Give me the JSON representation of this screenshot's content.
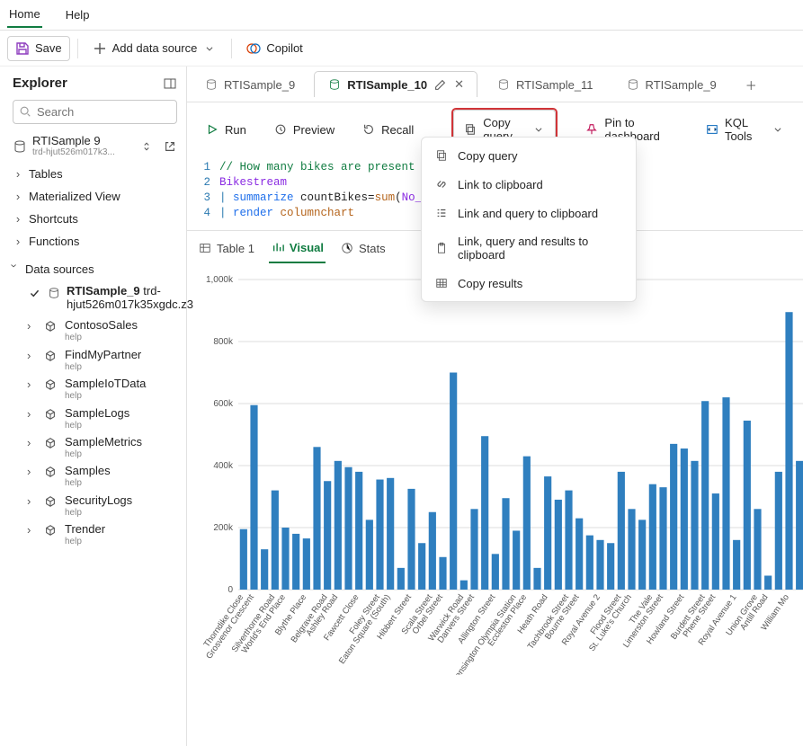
{
  "menu": {
    "home": "Home",
    "help": "Help"
  },
  "toolbar": {
    "save": "Save",
    "add_data_source": "Add data source",
    "copilot": "Copilot"
  },
  "explorer": {
    "title": "Explorer",
    "search_placeholder": "Search",
    "db": {
      "name": "RTISample 9",
      "sub": "trd-hjut526m017k3..."
    },
    "nodes": [
      "Tables",
      "Materialized View",
      "Shortcuts",
      "Functions"
    ],
    "ds_section": "Data sources",
    "ds_selected": {
      "name": "RTISample_9",
      "sub": "trd-hjut526m017k35xgdc.z3"
    },
    "datasources": [
      {
        "name": "ContosoSales",
        "help": "help"
      },
      {
        "name": "FindMyPartner",
        "help": "help"
      },
      {
        "name": "SampleIoTData",
        "help": "help"
      },
      {
        "name": "SampleLogs",
        "help": "help"
      },
      {
        "name": "SampleMetrics",
        "help": "help"
      },
      {
        "name": "Samples",
        "help": "help"
      },
      {
        "name": "SecurityLogs",
        "help": "help"
      },
      {
        "name": "Trender",
        "help": "help"
      }
    ]
  },
  "tabs": [
    {
      "label": "RTISample_9"
    },
    {
      "label": "RTISample_10",
      "active": true
    },
    {
      "label": "RTISample_11"
    },
    {
      "label": "RTISample_9"
    }
  ],
  "actions": {
    "run": "Run",
    "preview": "Preview",
    "recall": "Recall",
    "copy_query": "Copy query",
    "pin": "Pin to dashboard",
    "kql": "KQL Tools"
  },
  "copy_menu": {
    "items": [
      "Copy query",
      "Link to clipboard",
      "Link and query to clipboard",
      "Link, query and results to clipboard",
      "Copy results"
    ]
  },
  "code": {
    "l1": "// How many bikes are present",
    "l2": "Bikestream",
    "l3_pipe": "|",
    "l3_kw": "summarize",
    "l3_a": " countBikes=",
    "l3_fn": "sum",
    "l3_b": "(",
    "l3_arg": "No_",
    "l4_pipe": "|",
    "l4_kw": "render",
    "l4_a": " columnchart"
  },
  "results_tabs": {
    "table": "Table 1",
    "visual": "Visual",
    "stats": "Stats"
  },
  "chart_data": {
    "type": "bar",
    "ylabel": "",
    "ylim": [
      0,
      1000000
    ],
    "yticks": [
      "0",
      "200k",
      "400k",
      "600k",
      "800k",
      "1,000k"
    ],
    "categories": [
      "Thorndike Close",
      "Grosvenor Crescent",
      "Silverthorne Road",
      "World's End Place",
      "Blythe Place",
      "Belgrave Road",
      "Ashley Road",
      "Fawcett Close",
      "Foley Street",
      "Eaton Square (South)",
      "Hibbert Street",
      "Scala Street",
      "Orbel Street",
      "Warwick Road",
      "Danvers Street",
      "Allington Street",
      "Kensington Olympia Station",
      "Eccleston Place",
      "Heath Road",
      "Tachbrook Street",
      "Bourne Street",
      "Royal Avenue 2",
      "Flood Street",
      "St. Luke's Church",
      "The Vale",
      "Limerston Street",
      "Howland Street",
      "Burdett Street",
      "Phene Street",
      "Royal Avenue 1",
      "Union Grove",
      "Antill Road",
      "William Mo"
    ],
    "values": [
      195000,
      595000,
      130000,
      320000,
      200000,
      180000,
      165000,
      460000,
      350000,
      415000,
      395000,
      380000,
      225000,
      355000,
      360000,
      70000,
      325000,
      150000,
      250000,
      105000,
      700000,
      30000,
      260000,
      495000,
      115000,
      295000,
      190000,
      430000,
      70000,
      365000,
      290000,
      320000,
      230000,
      175000,
      160000,
      150000,
      380000,
      260000,
      225000,
      340000,
      330000,
      470000,
      455000,
      415000,
      608000,
      310000,
      620000,
      160000,
      545000,
      260000,
      45000,
      380000,
      895000,
      415000
    ]
  }
}
